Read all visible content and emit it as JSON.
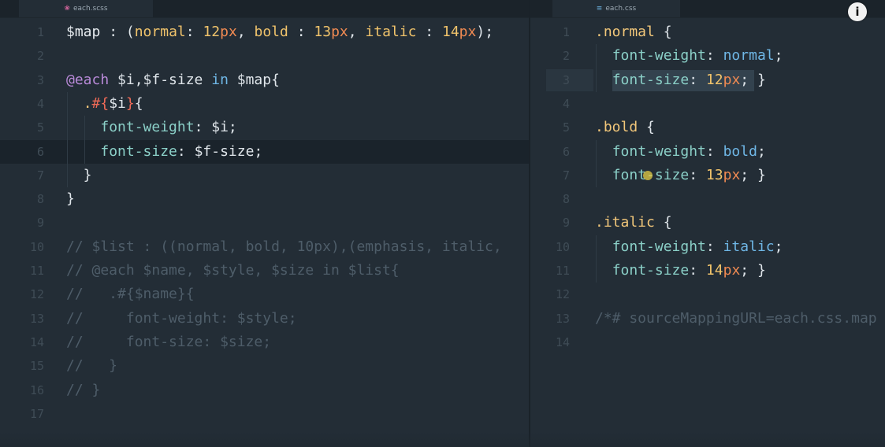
{
  "left_pane": {
    "tab_label": "each.scss",
    "tab_icon": "sass-icon",
    "current_line": 6,
    "lines": [
      {
        "n": "1",
        "tokens": [
          [
            "var",
            "$map"
          ],
          [
            "plain",
            " : ("
          ],
          [
            "val",
            "normal"
          ],
          [
            "plain",
            ": "
          ],
          [
            "val",
            "12"
          ],
          [
            "unit",
            "px"
          ],
          [
            "plain",
            ", "
          ],
          [
            "val",
            "bold"
          ],
          [
            "plain",
            " : "
          ],
          [
            "val",
            "13"
          ],
          [
            "unit",
            "px"
          ],
          [
            "plain",
            ", "
          ],
          [
            "val",
            "italic"
          ],
          [
            "plain",
            " : "
          ],
          [
            "val",
            "14"
          ],
          [
            "unit",
            "px"
          ],
          [
            "plain",
            ");"
          ]
        ]
      },
      {
        "n": "2",
        "tokens": []
      },
      {
        "n": "3",
        "tokens": [
          [
            "at",
            "@each"
          ],
          [
            "plain",
            " $i,$f-size "
          ],
          [
            "kw",
            "in"
          ],
          [
            "plain",
            " $map{"
          ]
        ]
      },
      {
        "n": "4",
        "tokens": [
          [
            "plain",
            "  "
          ],
          [
            "sel",
            "."
          ],
          [
            "interp",
            "#{"
          ],
          [
            "plain",
            "$i"
          ],
          [
            "interp",
            "}"
          ],
          [
            "plain",
            "{"
          ]
        ]
      },
      {
        "n": "5",
        "tokens": [
          [
            "plain",
            "    "
          ],
          [
            "key",
            "font-weight"
          ],
          [
            "plain",
            ": $i;"
          ]
        ]
      },
      {
        "n": "6",
        "tokens": [
          [
            "plain",
            "    "
          ],
          [
            "key",
            "font-size"
          ],
          [
            "plain",
            ": $f-size;"
          ]
        ]
      },
      {
        "n": "7",
        "tokens": [
          [
            "plain",
            "  }"
          ]
        ]
      },
      {
        "n": "8",
        "tokens": [
          [
            "plain",
            "}"
          ]
        ]
      },
      {
        "n": "9",
        "tokens": []
      },
      {
        "n": "10",
        "tokens": [
          [
            "comment",
            "// $list : ((normal, bold, 10px),(emphasis, italic,"
          ]
        ]
      },
      {
        "n": "11",
        "tokens": [
          [
            "comment",
            "// @each $name, $style, $size in $list{"
          ]
        ]
      },
      {
        "n": "12",
        "tokens": [
          [
            "comment",
            "//   .#{$name}{"
          ]
        ]
      },
      {
        "n": "13",
        "tokens": [
          [
            "comment",
            "//     font-weight: $style;"
          ]
        ]
      },
      {
        "n": "14",
        "tokens": [
          [
            "comment",
            "//     font-size: $size;"
          ]
        ]
      },
      {
        "n": "15",
        "tokens": [
          [
            "comment",
            "//   }"
          ]
        ]
      },
      {
        "n": "16",
        "tokens": [
          [
            "comment",
            "// }"
          ]
        ]
      },
      {
        "n": "17",
        "tokens": []
      }
    ]
  },
  "right_pane": {
    "tab_label": "each.css",
    "tab_icon": "css-file-icon",
    "current_line": 3,
    "lines": [
      {
        "n": "1",
        "tokens": [
          [
            "sel",
            ".normal"
          ],
          [
            "plain",
            " {"
          ]
        ]
      },
      {
        "n": "2",
        "tokens": [
          [
            "plain",
            "  "
          ],
          [
            "key",
            "font-weight"
          ],
          [
            "plain",
            ": "
          ],
          [
            "kw",
            "normal"
          ],
          [
            "plain",
            ";"
          ]
        ]
      },
      {
        "n": "3",
        "tokens": [
          [
            "plain",
            "  "
          ],
          [
            "key",
            "font-size"
          ],
          [
            "plain",
            ": "
          ],
          [
            "val",
            "12"
          ],
          [
            "unit",
            "px"
          ],
          [
            "plain",
            "; }"
          ]
        ]
      },
      {
        "n": "4",
        "tokens": []
      },
      {
        "n": "5",
        "tokens": [
          [
            "sel",
            ".bold"
          ],
          [
            "plain",
            " {"
          ]
        ]
      },
      {
        "n": "6",
        "tokens": [
          [
            "plain",
            "  "
          ],
          [
            "key",
            "font-weight"
          ],
          [
            "plain",
            ": "
          ],
          [
            "kw",
            "bold"
          ],
          [
            "plain",
            ";"
          ]
        ]
      },
      {
        "n": "7",
        "tokens": [
          [
            "plain",
            "  "
          ],
          [
            "key",
            "font-size"
          ],
          [
            "plain",
            ": "
          ],
          [
            "val",
            "13"
          ],
          [
            "unit",
            "px"
          ],
          [
            "plain",
            "; }"
          ]
        ]
      },
      {
        "n": "8",
        "tokens": []
      },
      {
        "n": "9",
        "tokens": [
          [
            "sel",
            ".italic"
          ],
          [
            "plain",
            " {"
          ]
        ]
      },
      {
        "n": "10",
        "tokens": [
          [
            "plain",
            "  "
          ],
          [
            "key",
            "font-weight"
          ],
          [
            "plain",
            ": "
          ],
          [
            "kw",
            "italic"
          ],
          [
            "plain",
            ";"
          ]
        ]
      },
      {
        "n": "11",
        "tokens": [
          [
            "plain",
            "  "
          ],
          [
            "key",
            "font-size"
          ],
          [
            "plain",
            ": "
          ],
          [
            "val",
            "14"
          ],
          [
            "unit",
            "px"
          ],
          [
            "plain",
            "; }"
          ]
        ]
      },
      {
        "n": "12",
        "tokens": []
      },
      {
        "n": "13",
        "tokens": [
          [
            "comment",
            "/*# sourceMappingURL=each.css.map"
          ]
        ]
      },
      {
        "n": "14",
        "tokens": []
      }
    ]
  },
  "info_button": {
    "label": "i",
    "icon": "info-icon"
  },
  "colors": {
    "background": "#232d36",
    "property": "#8bd0c8",
    "value": "#f0c36b",
    "unit": "#f08a52",
    "at_rule": "#b98ad9",
    "keyword": "#6fb7e6",
    "interpolation": "#ef6a57",
    "comment": "#4e5d69"
  }
}
